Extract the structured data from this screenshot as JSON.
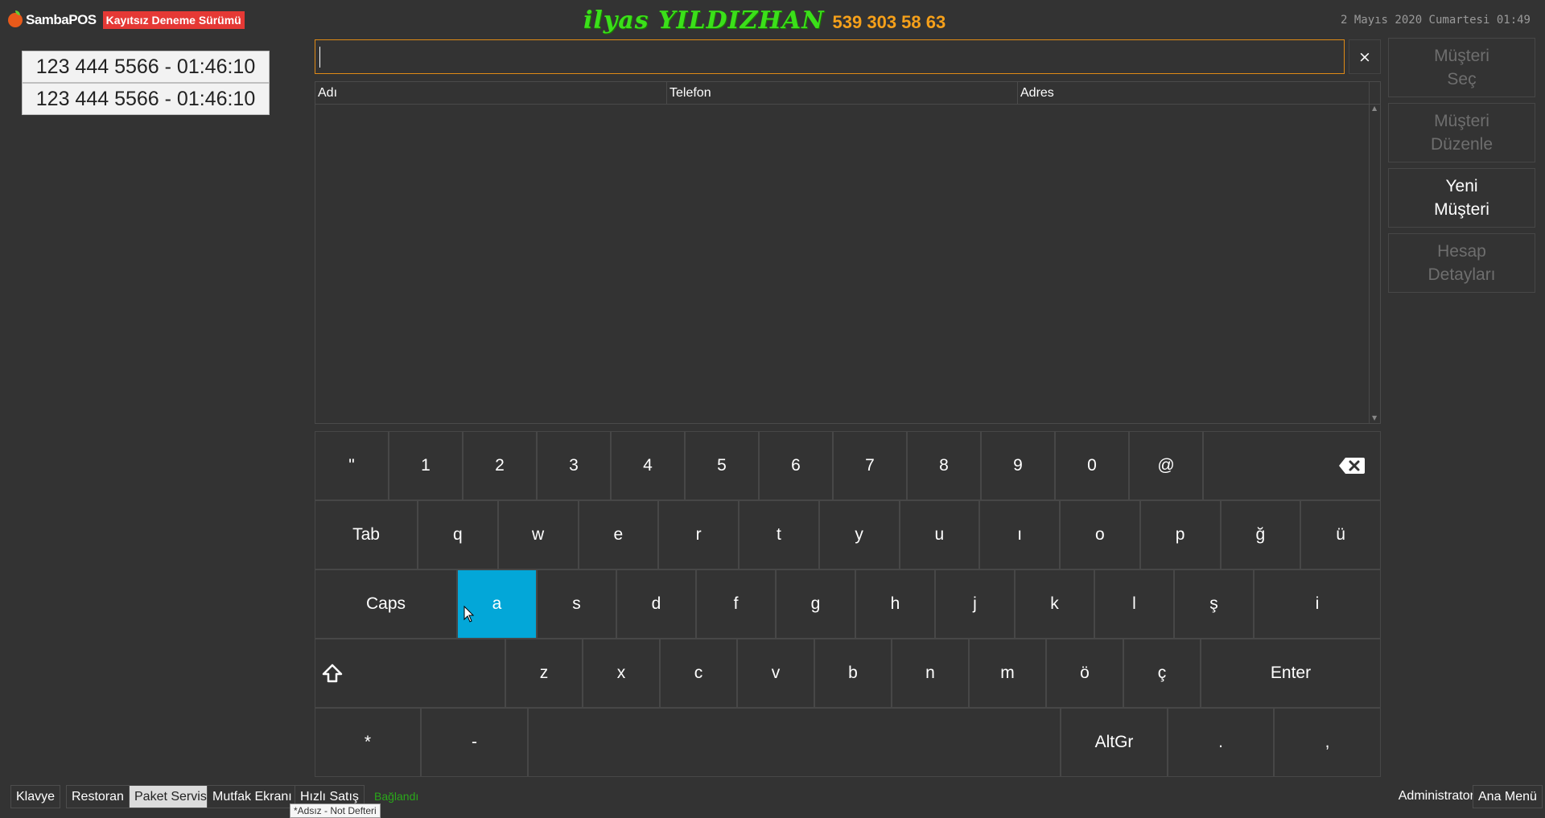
{
  "header": {
    "logo_text": "SambaPOS",
    "trial_badge": "Kayıtsız Deneme Sürümü",
    "brand_name": "ilyas YILDIZHAN",
    "brand_phone": "539 303 58 63",
    "datetime": "2 Mayıs 2020 Cumartesi 01:49",
    "colors": {
      "brand_name": "#3be01a",
      "brand_phone": "#f6a01a",
      "trial_badge": "#e53935"
    }
  },
  "caller_list": [
    "123 444 5566 - 01:46:10",
    "123 444 5566 - 01:46:10"
  ],
  "search": {
    "value": "",
    "clear_label": "×"
  },
  "grid": {
    "columns": [
      "Adı",
      "Telefon",
      "Adres"
    ],
    "rows": []
  },
  "side_buttons": [
    {
      "label": "Müşteri\nSeç",
      "enabled": false
    },
    {
      "label": "Müşteri\nDüzenle",
      "enabled": false
    },
    {
      "label": "Yeni\nMüşteri",
      "enabled": true
    },
    {
      "label": "Hesap\nDetayları",
      "enabled": false
    }
  ],
  "keyboard": {
    "highlight_key": "a",
    "rows": [
      [
        "\"",
        "1",
        "2",
        "3",
        "4",
        "5",
        "6",
        "7",
        "8",
        "9",
        "0",
        "@",
        "backspace-icon"
      ],
      [
        "Tab",
        "q",
        "w",
        "e",
        "r",
        "t",
        "y",
        "u",
        "ı",
        "o",
        "p",
        "ğ",
        "ü"
      ],
      [
        "Caps",
        "a",
        "s",
        "d",
        "f",
        "g",
        "h",
        "j",
        "k",
        "l",
        "ş",
        "i"
      ],
      [
        "shift-icon",
        "z",
        "x",
        "c",
        "v",
        "b",
        "n",
        "m",
        "ö",
        "ç",
        "Enter"
      ],
      [
        "*",
        "-",
        "",
        "AltGr",
        ".",
        ","
      ]
    ]
  },
  "bottom_bar": {
    "tabs": [
      "Klavye",
      "Restoran",
      "Paket Servis",
      "Mutfak Ekranı",
      "Hızlı Satış"
    ],
    "selected_tab": "Paket Servis",
    "status": "Bağlandı",
    "tooltip": "*Adsız - Not Defteri",
    "user": "Administrator",
    "main_menu": "Ana Menü"
  }
}
